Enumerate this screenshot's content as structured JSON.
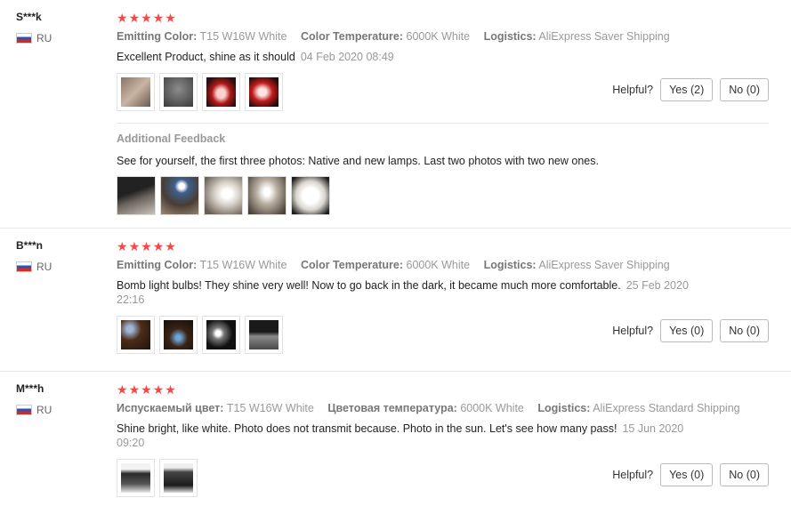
{
  "helpful_label": "Helpful?",
  "additional_feedback_title": "Additional Feedback",
  "reviews": [
    {
      "user": "S***k",
      "country": "RU",
      "rating": 5,
      "attrs": [
        {
          "label": "Emitting Color:",
          "value": "T15 W16W White"
        },
        {
          "label": "Color Temperature:",
          "value": "6000K White"
        },
        {
          "label": "Logistics:",
          "value": "AliExpress Saver Shipping"
        }
      ],
      "content": "Excellent Product, shine as it should",
      "date": "04 Feb 2020 08:49",
      "yes": "Yes (2)",
      "no": "No (0)",
      "additional_feedback": "See for yourself, the first three photos: Native and new lamps. Last two photos with two new ones."
    },
    {
      "user": "B***n",
      "country": "RU",
      "rating": 5,
      "attrs": [
        {
          "label": "Emitting Color:",
          "value": "T15 W16W White"
        },
        {
          "label": "Color Temperature:",
          "value": "6000K White"
        },
        {
          "label": "Logistics:",
          "value": "AliExpress Saver Shipping"
        }
      ],
      "content": "Bomb light bulbs! They shine very well! Now to go back in the dark, it became much more comfortable.",
      "date_line1": "25 Feb 2020",
      "date_line2": "22:16",
      "yes": "Yes (0)",
      "no": "No (0)"
    },
    {
      "user": "M***h",
      "country": "RU",
      "rating": 5,
      "attrs": [
        {
          "label": "Испускаемый цвет:",
          "value": "T15 W16W White"
        },
        {
          "label": "Цветовая температура:",
          "value": "6000K White"
        },
        {
          "label": "Logistics:",
          "value": "AliExpress Standard Shipping"
        }
      ],
      "content": "Shine bright, like white. Photo does not transmit because. Photo in the sun. Let's see how many pass!",
      "date_line1": "15 Jun 2020",
      "date_line2": "09:20",
      "yes": "Yes (0)",
      "no": "No (0)"
    }
  ],
  "colors": {
    "star": "#ff4444",
    "attr_text": "#999999",
    "border": "#e8e8e8"
  }
}
